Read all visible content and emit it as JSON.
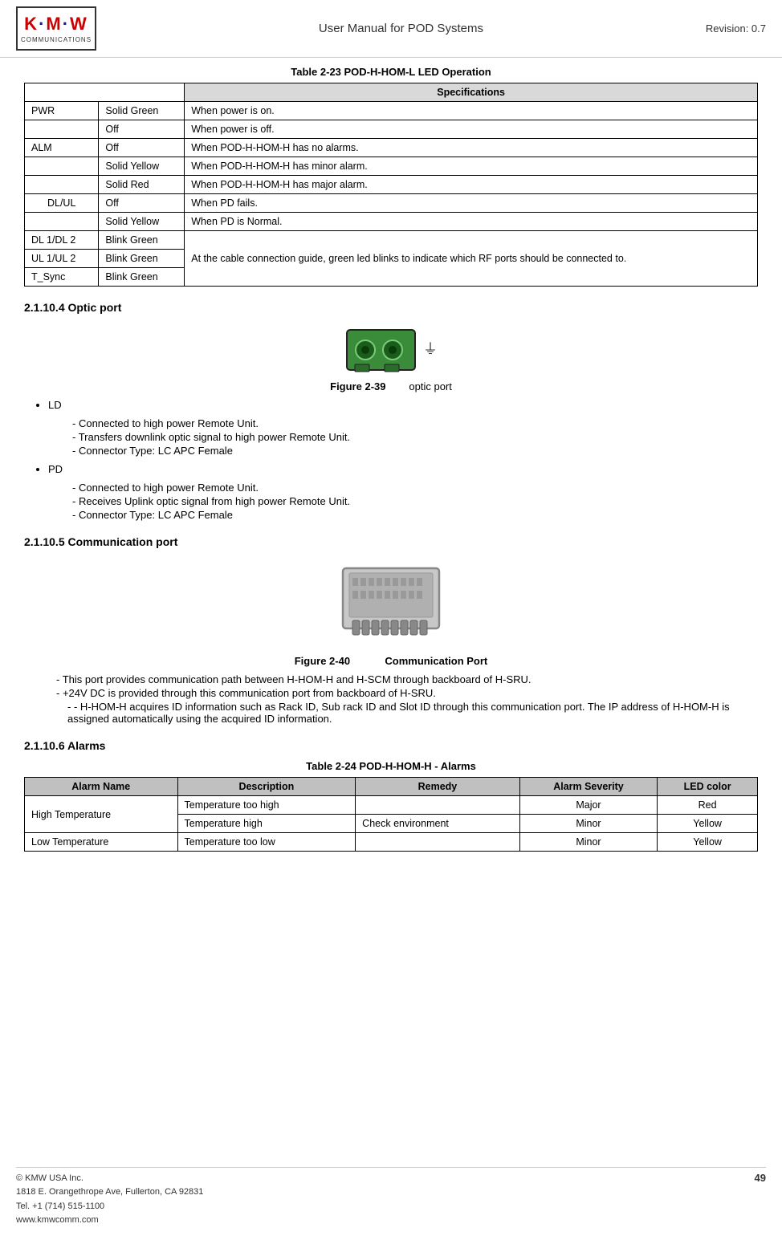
{
  "header": {
    "logo_kmw": "KMW",
    "logo_communications": "COMMUNICATIONS",
    "title": "User Manual for POD Systems",
    "revision": "Revision: 0.7"
  },
  "table23": {
    "caption": "Table 2-23    POD-H-HOM-L LED Operation",
    "spec_col": "Specifications",
    "rows": [
      {
        "col1": "PWR",
        "col2": "Solid Green",
        "col3": "When power is on."
      },
      {
        "col1": "",
        "col2": "Off",
        "col3": "When power is off."
      },
      {
        "col1": "ALM",
        "col2": "Off",
        "col3": "When POD-H-HOM-H has no alarms."
      },
      {
        "col1": "",
        "col2": "Solid Yellow",
        "col3": "When POD-H-HOM-H has minor alarm."
      },
      {
        "col1": "",
        "col2": "Solid Red",
        "col3": "When POD-H-HOM-H has major alarm."
      },
      {
        "col1": "DL/UL",
        "col2": "Off",
        "col3": "When PD fails."
      },
      {
        "col1": "",
        "col2": "Solid Yellow",
        "col3": "When PD is Normal."
      },
      {
        "col1": "DL 1/DL 2",
        "col2": "Blink Green",
        "col3": "at_cable"
      },
      {
        "col1": "UL 1/UL 2",
        "col2": "Blink Green",
        "col3": "at_cable"
      },
      {
        "col1": "T_Sync",
        "col2": "Blink Green",
        "col3": "at_cable"
      }
    ],
    "cable_note": "At the cable connection guide, green led blinks to indicate which RF ports should be connected to."
  },
  "section2110_4": {
    "heading": "2.1.10.4 Optic port",
    "figure_num": "Figure 2-39",
    "figure_label": "optic port"
  },
  "ld_section": {
    "title": "LD",
    "items": [
      "Connected to high power Remote Unit.",
      "Transfers downlink optic signal to high power Remote Unit.",
      "Connector Type: LC APC Female"
    ]
  },
  "pd_section": {
    "title": "PD",
    "items": [
      "Connected to high power Remote Unit.",
      "Receives Uplink optic signal from high power Remote Unit.",
      "Connector Type: LC APC Female"
    ]
  },
  "section2110_5": {
    "heading": "2.1.10.5 Communication port",
    "figure_num": "Figure 2-40",
    "figure_label": "Communication Port"
  },
  "comm_bullets": [
    "This port provides communication path between H-HOM-H and H-SCM through backboard of H-SRU.",
    "+24V DC is provided through this communication port from backboard of H-SRU.",
    "H-HOM-H acquires ID information such as Rack ID, Sub rack ID and Slot ID through this communication port. The IP address of H-HOM-H is assigned automatically using the acquired ID information."
  ],
  "section2110_6": {
    "heading": "2.1.10.6 Alarms"
  },
  "table24": {
    "caption": "Table 2-24    POD-H-HOM-H - Alarms",
    "headers": {
      "alarm_name": "Alarm Name",
      "description": "Description",
      "remedy": "Remedy",
      "alarm_severity": "Alarm Severity",
      "led_color": "LED color"
    },
    "rows": [
      {
        "alarm_name": "High Temperature",
        "description": "Temperature too high",
        "remedy": "",
        "severity": "Major",
        "led": "Red"
      },
      {
        "alarm_name": "",
        "description": "Temperature high",
        "remedy": "Check environment",
        "severity": "Minor",
        "led": "Yellow"
      },
      {
        "alarm_name": "Low Temperature",
        "description": "Temperature too low",
        "remedy": "",
        "severity": "Minor",
        "led": "Yellow"
      }
    ]
  },
  "footer": {
    "company": "© KMW USA Inc.",
    "address": "1818 E. Orangethrope Ave, Fullerton, CA 92831",
    "tel": "Tel. +1 (714) 515-1100",
    "web": "www.kmwcomm.com",
    "page": "49"
  }
}
